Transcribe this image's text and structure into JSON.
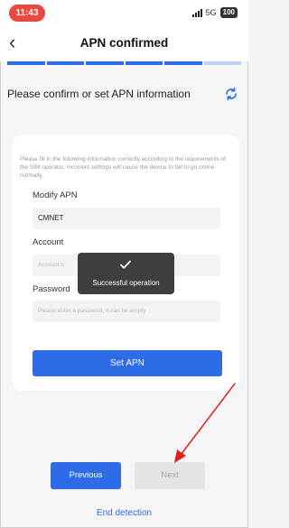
{
  "status_bar": {
    "time": "11:43",
    "network": "5G",
    "battery": "100"
  },
  "nav": {
    "back_icon": "chevron-left-icon",
    "title": "APN confirmed"
  },
  "progress": {
    "steps_total": 6,
    "steps_completed": 5
  },
  "section": {
    "title": "Please confirm or set APN information",
    "refresh_icon": "refresh-icon"
  },
  "form": {
    "instructions": "Please fill in the following information correctly according to the requirements of the SIM operator. Incorrect settings will cause the device to fail to go online normally.",
    "apn_label": "Modify APN",
    "apn_value": "CMNET",
    "account_label": "Account",
    "account_placeholder": "Account n",
    "password_label": "Password",
    "password_placeholder": "Please enter a password, it can be empty",
    "set_apn_label": "Set APN"
  },
  "toast": {
    "icon": "check-icon",
    "text": "Successful operation"
  },
  "footer": {
    "previous_label": "Previous",
    "next_label": "Next",
    "end_detection_label": "End detection"
  },
  "colors": {
    "accent": "#2e6be6",
    "time_pill": "#e9473f",
    "annotation_arrow": "#e02020",
    "toast_bg": "#3e3e3e",
    "disabled_button": "#e4e4e6"
  }
}
